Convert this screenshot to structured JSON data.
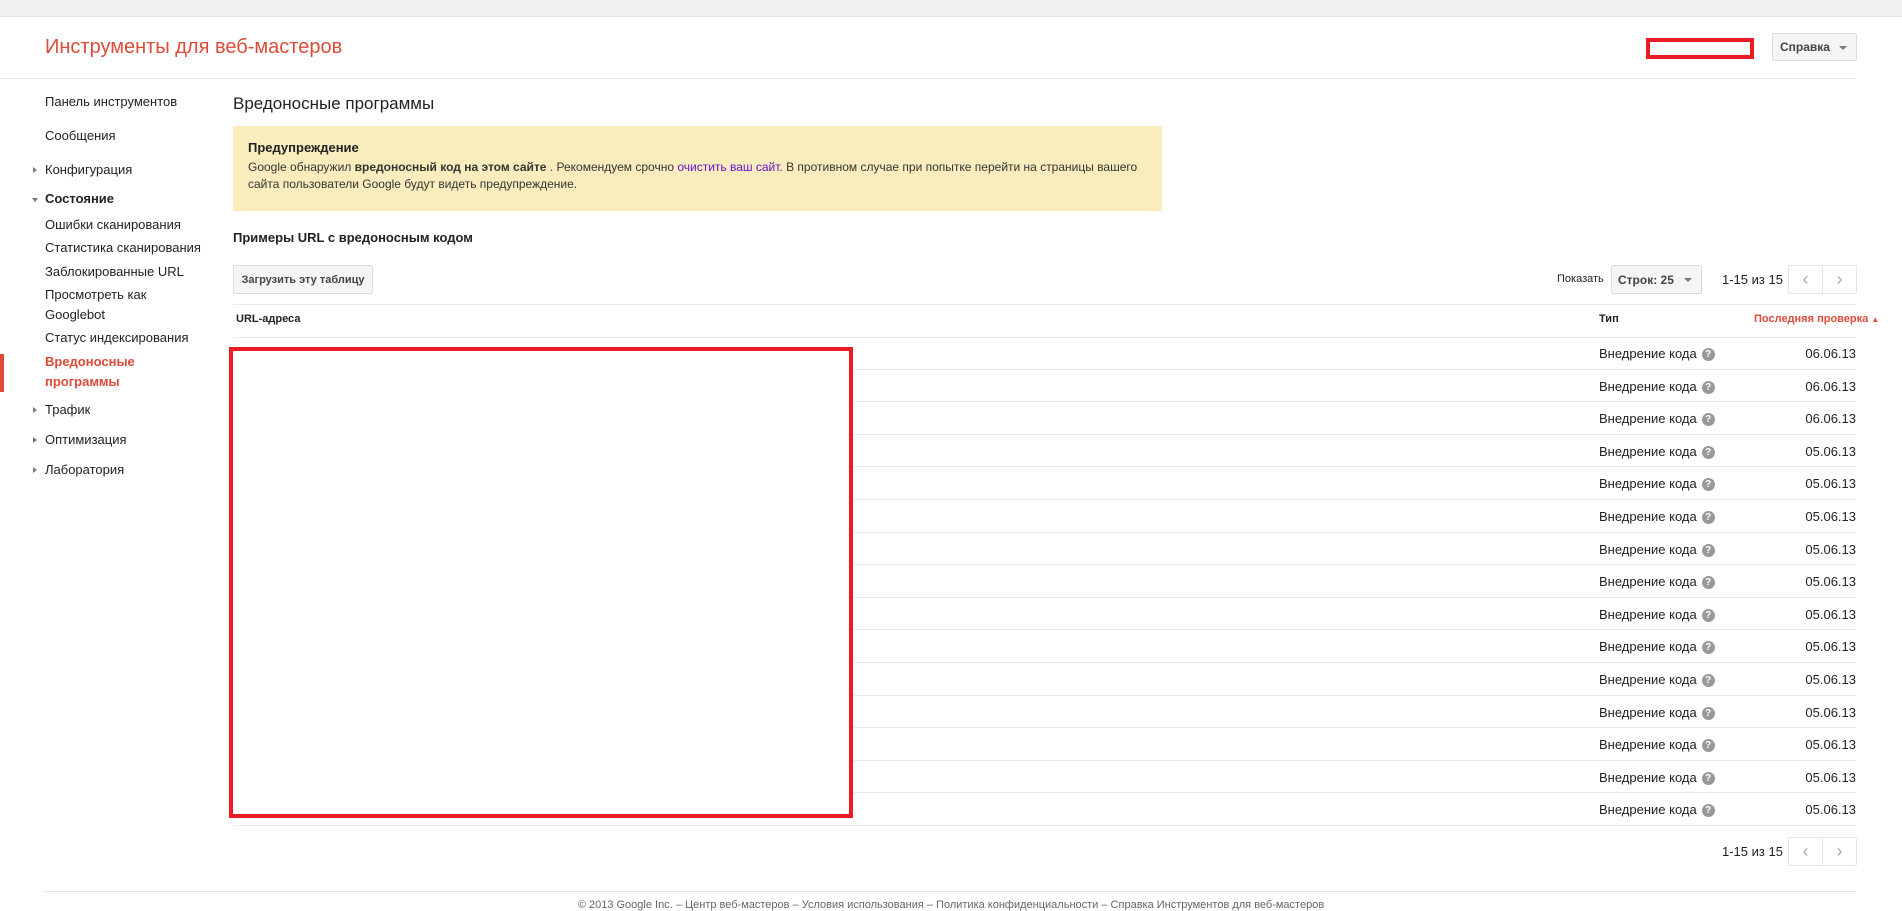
{
  "header": {
    "title": "Инструменты для веб-мастеров",
    "help_label": "Справка"
  },
  "sidebar": {
    "items": [
      {
        "label": "Панель инструментов"
      },
      {
        "label": "Сообщения"
      },
      {
        "label": "Конфигурация"
      },
      {
        "label": "Состояние"
      },
      {
        "label": "Ошибки сканирования"
      },
      {
        "label": "Статистика сканирования"
      },
      {
        "label": "Заблокированные URL"
      },
      {
        "label": "Просмотреть как Googlebot"
      },
      {
        "label": "Статус индексирования"
      },
      {
        "label": "Вредоносные программы"
      },
      {
        "label": "Трафик"
      },
      {
        "label": "Оптимизация"
      },
      {
        "label": "Лаборатория"
      }
    ]
  },
  "main": {
    "heading": "Вредоносные программы",
    "warning": {
      "title": "Предупреждение",
      "text_1": "Google обнаружил ",
      "bold": "вредоносный код на этом сайте",
      "text_2": " . Рекомендуем срочно ",
      "link": "очистить ваш сайт",
      "text_3": ". В противном случае при попытке перейти на страницы вашего сайта пользователи Google будут видеть предупреждение."
    },
    "examples_title": "Примеры URL с вредоносным кодом",
    "download_label": "Загрузить эту таблицу",
    "show_label": "Показать",
    "rows_select": "Строк: 25",
    "pagination": "1-15 из 15",
    "prev_icon": "‹",
    "next_icon": "›",
    "table": {
      "columns": [
        "URL-адреса",
        "Тип",
        "Последняя проверка"
      ],
      "sort_indicator": "▲",
      "rows": [
        {
          "type": "Внедрение кода",
          "date": "06.06.13"
        },
        {
          "type": "Внедрение кода",
          "date": "06.06.13"
        },
        {
          "type": "Внедрение кода",
          "date": "06.06.13"
        },
        {
          "type": "Внедрение кода",
          "date": "05.06.13"
        },
        {
          "type": "Внедрение кода",
          "date": "05.06.13"
        },
        {
          "type": "Внедрение кода",
          "date": "05.06.13"
        },
        {
          "type": "Внедрение кода",
          "date": "05.06.13"
        },
        {
          "type": "Внедрение кода",
          "date": "05.06.13"
        },
        {
          "type": "Внедрение кода",
          "date": "05.06.13"
        },
        {
          "type": "Внедрение кода",
          "date": "05.06.13"
        },
        {
          "type": "Внедрение кода",
          "date": "05.06.13"
        },
        {
          "type": "Внедрение кода",
          "date": "05.06.13"
        },
        {
          "type": "Внедрение кода",
          "date": "05.06.13"
        },
        {
          "type": "Внедрение кода",
          "date": "05.06.13"
        },
        {
          "type": "Внедрение кода",
          "date": "05.06.13"
        }
      ]
    }
  },
  "footer": {
    "text": "© 2013 Google Inc. – Центр веб-мастеров – Условия использования – Политика конфиденциальности – Справка Инструментов для веб-мастеров"
  },
  "colors": {
    "brand_red": "#dd4b39",
    "warning_bg": "#f9edbe",
    "link": "#6611cc",
    "redaction": "#ed1c24"
  }
}
